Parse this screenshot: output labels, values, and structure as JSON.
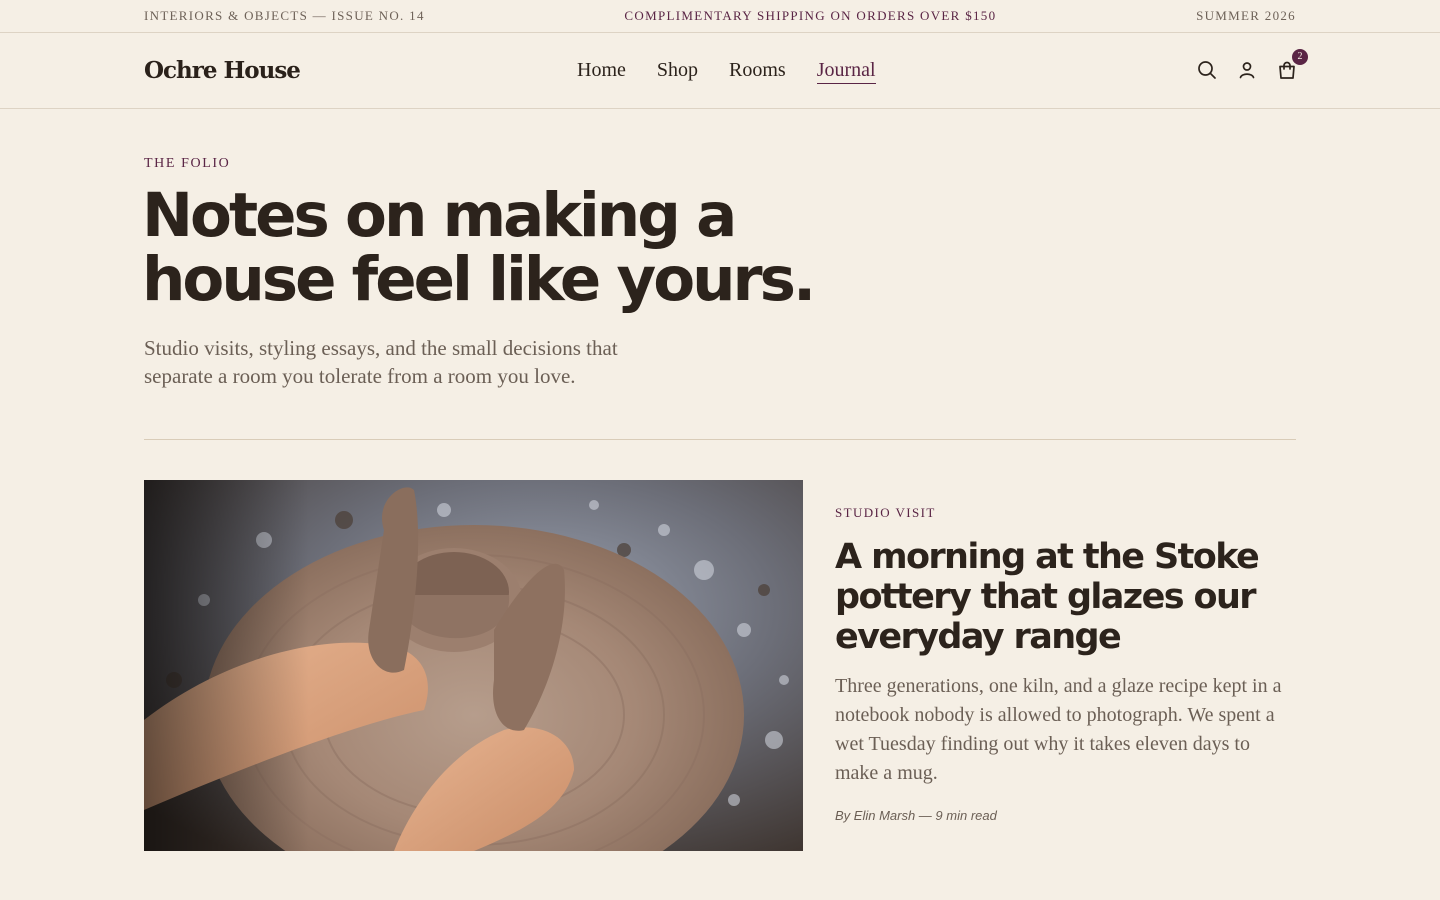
{
  "topbar": {
    "issue": "INTERIORS & OBJECTS — ISSUE NO. 14",
    "promo": "COMPLIMENTARY SHIPPING ON ORDERS OVER $150",
    "season": "SUMMER 2026"
  },
  "header": {
    "logo": "Ochre House",
    "nav": [
      {
        "label": "Home"
      },
      {
        "label": "Shop"
      },
      {
        "label": "Rooms"
      },
      {
        "label": "Journal",
        "active": true
      }
    ],
    "icons": [
      "search-icon",
      "account-icon",
      "cart-icon"
    ],
    "cart_count": "2"
  },
  "hero": {
    "eyebrow": "THE FOLIO",
    "title": "Notes on making a house feel like yours.",
    "subtitle": "Studio visits, styling essays, and the small decisions that separate a room you tolerate from a room you love."
  },
  "feature": {
    "kicker": "STUDIO VISIT",
    "title": "A morning at the Stoke pottery that glazes our everyday range",
    "excerpt": "Three generations, one kiln, and a glaze recipe kept in a notebook nobody is allowed to photograph. We spent a wet Tuesday finding out why it takes eleven days to make a mug.",
    "byline": "By Elin Marsh — 9 min read"
  },
  "colors": {
    "background": "#f5efe5",
    "accent": "#5a2545",
    "text": "#2c231c",
    "muted": "#6b5f55"
  }
}
